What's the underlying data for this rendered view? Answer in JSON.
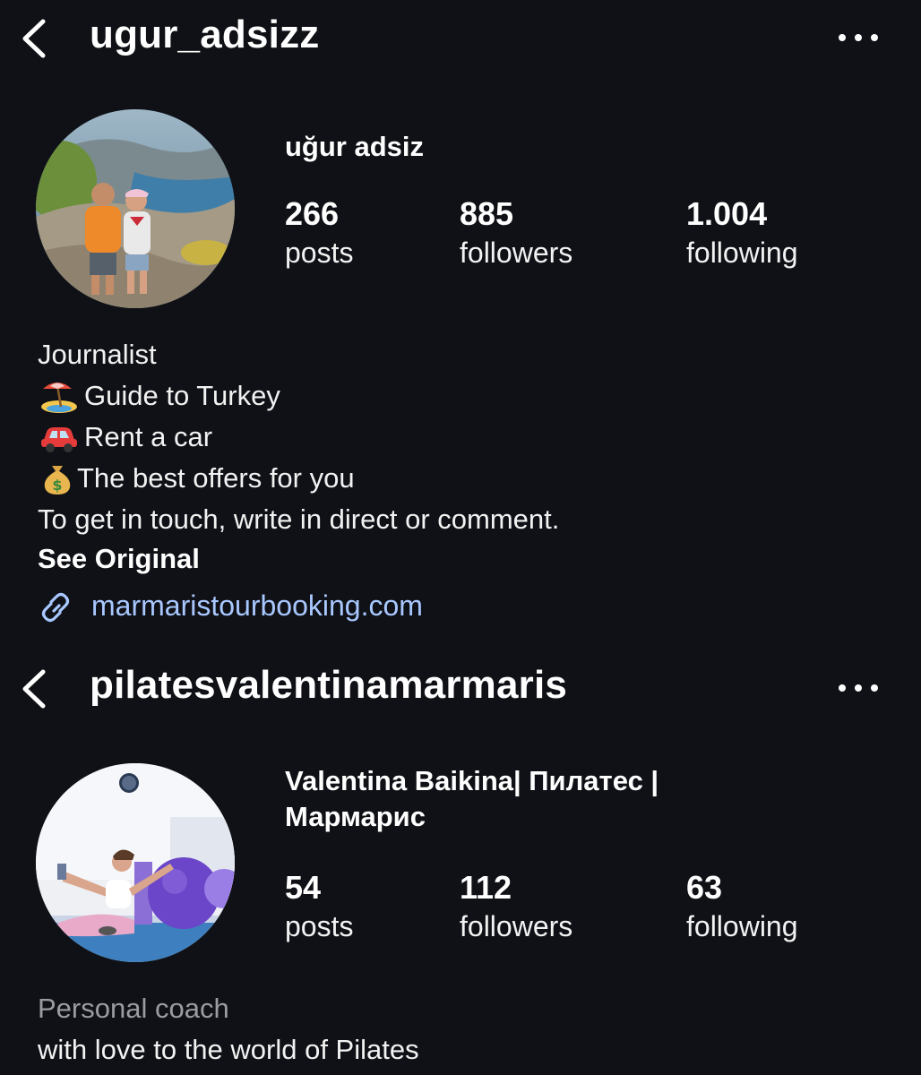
{
  "profiles": [
    {
      "username": "ugur_adsizz",
      "display_name": "uğur adsiz",
      "stats": [
        {
          "value": "266",
          "label": "posts"
        },
        {
          "value": "885",
          "label": "followers"
        },
        {
          "value": "1.004",
          "label": "following"
        }
      ],
      "bio": {
        "occupation": "Journalist",
        "lines": [
          {
            "icon": "beach-umbrella-icon",
            "text": "Guide to Turkey"
          },
          {
            "icon": "red-car-icon",
            "text": "Rent a car"
          },
          {
            "icon": "money-bag-icon",
            "text": "The best offers for you"
          }
        ],
        "contact": "To get in touch, write in direct or comment.",
        "see_original": "See Original",
        "link": "marmaristourbooking.com"
      }
    },
    {
      "username": "pilatesvalentinamarmaris",
      "display_name_line1": "Valentina Baikina| Пилатес |",
      "display_name_line2": "Мармарис",
      "stats": [
        {
          "value": "54",
          "label": "posts"
        },
        {
          "value": "112",
          "label": "followers"
        },
        {
          "value": "63",
          "label": "following"
        }
      ],
      "bio": {
        "category": "Personal coach",
        "line1": "with love to the world of Pilates"
      }
    }
  ],
  "colors": {
    "background": "#0f1116",
    "text": "#f5f5f5",
    "link": "#a9c8ff",
    "muted": "#9a9ca3"
  }
}
